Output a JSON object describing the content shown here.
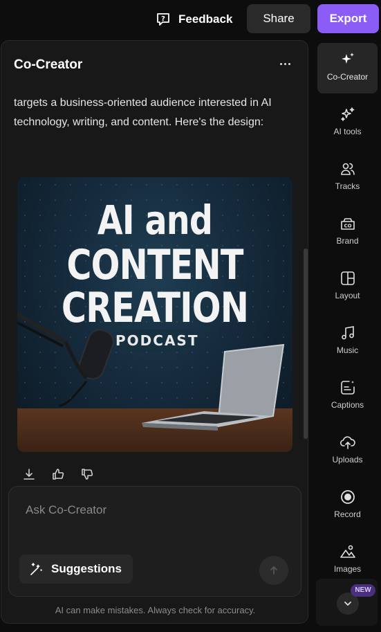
{
  "topbar": {
    "feedback_label": "Feedback",
    "share_label": "Share",
    "export_label": "Export"
  },
  "panel": {
    "title": "Co-Creator",
    "message": "targets a business-oriented audience interested in AI technology, writing, and content. Here's the design:",
    "artwork": {
      "line1": "AI and",
      "line2": "CONTENT",
      "line3": "CREATION",
      "tag": "PODCAST"
    },
    "input_placeholder": "Ask Co-Creator",
    "suggestions_label": "Suggestions",
    "disclaimer": "AI can make mistakes. Always check for accuracy."
  },
  "sidebar": {
    "items": [
      {
        "label": "Co-Creator",
        "icon": "sparkle-icon",
        "active": true
      },
      {
        "label": "AI tools",
        "icon": "sparkles-outline-icon"
      },
      {
        "label": "Tracks",
        "icon": "users-icon"
      },
      {
        "label": "Brand",
        "icon": "brand-kit-icon"
      },
      {
        "label": "Layout",
        "icon": "layout-icon"
      },
      {
        "label": "Music",
        "icon": "music-note-icon"
      },
      {
        "label": "Captions",
        "icon": "captions-icon"
      },
      {
        "label": "Uploads",
        "icon": "cloud-upload-icon"
      },
      {
        "label": "Record",
        "icon": "record-icon"
      },
      {
        "label": "Images",
        "icon": "images-icon"
      }
    ],
    "new_badge": "NEW"
  },
  "colors": {
    "accent": "#8b5cf6",
    "background": "#0d0d0d",
    "panel": "#181818"
  }
}
